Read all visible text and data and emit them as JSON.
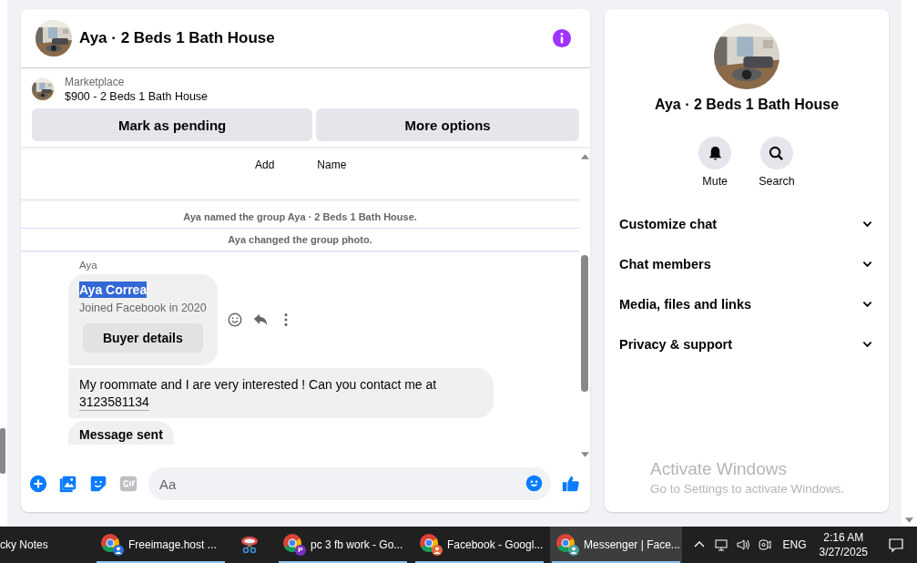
{
  "conversation": {
    "title": "Aya · 2 Beds 1 Bath House"
  },
  "listing": {
    "source": "Marketplace",
    "title": "$900 - 2 Beds 1 Bath House",
    "actions": [
      "Mark as pending",
      "More options"
    ]
  },
  "chat": {
    "top_actions": [
      "Add",
      "Name"
    ],
    "events": [
      "Aya named the group Aya · 2 Beds 1 Bath House.",
      "Aya changed the group photo."
    ],
    "sender": "Aya",
    "buyer_card": {
      "name": "Aya Correa",
      "name_highlighted": true,
      "joined": "Joined Facebook in 2020",
      "button": "Buyer details"
    },
    "message": "My roommate and I are very interested ! Can you contact me at",
    "phone": "3123581134",
    "status": "Message sent"
  },
  "composer": {
    "placeholder": "Aa"
  },
  "details": {
    "title": "Aya · 2 Beds 1 Bath House",
    "actions": [
      {
        "kind": "mute",
        "label": "Mute"
      },
      {
        "kind": "search",
        "label": "Search"
      }
    ],
    "sections": [
      {
        "label": "Customize chat",
        "expanded": false
      },
      {
        "label": "Chat members",
        "expanded": false
      },
      {
        "label": "Media, files and links",
        "expanded": false
      },
      {
        "label": "Privacy & support",
        "expanded": false
      }
    ]
  },
  "watermark": {
    "title": "Activate Windows",
    "subtitle": "Go to Settings to activate Windows."
  },
  "taskbar": {
    "apps": [
      {
        "kind": "notes",
        "label": "cky Notes",
        "selected": false
      },
      {
        "kind": "browser",
        "label": "Freeimage.host ...",
        "color": "#2f6fd6",
        "selected": false
      },
      {
        "kind": "snip",
        "selected": false
      },
      {
        "kind": "browser",
        "label": "pc 3 fb work - Go...",
        "color": "#7b2fbf",
        "badge": "P",
        "selected": false
      },
      {
        "kind": "browser",
        "label": "Facebook - Googl...",
        "color": "#e8663d",
        "selected": false
      },
      {
        "kind": "browser",
        "label": "Messenger | Face...",
        "color": "#4aa3a3",
        "selected": true
      }
    ],
    "language": "ENG",
    "time": "2:16 AM",
    "date": "3/27/2025"
  }
}
